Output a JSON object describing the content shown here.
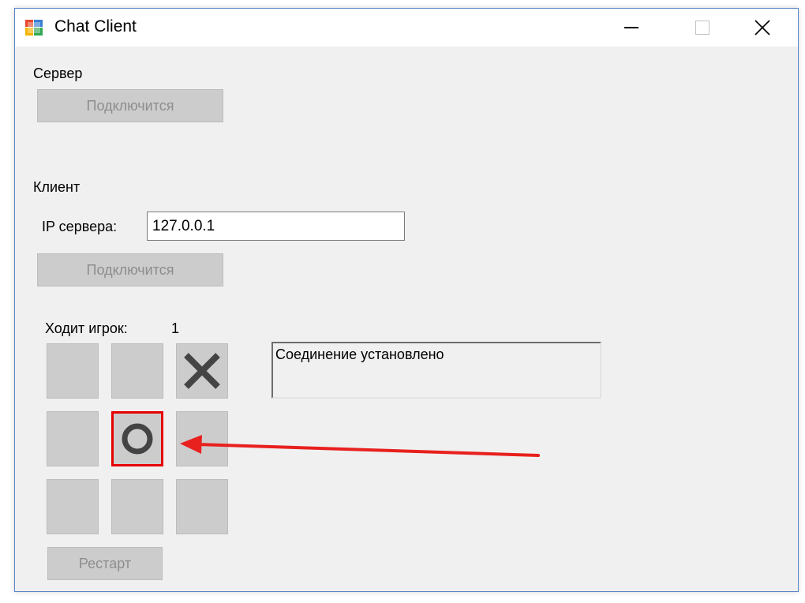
{
  "window": {
    "title": "Chat Client",
    "controls": {
      "minimize": "minimize",
      "maximize": "maximize",
      "close": "close"
    }
  },
  "server": {
    "section_label": "Сервер",
    "connect_button": "Подключится"
  },
  "client": {
    "section_label": "Клиент",
    "ip_label": "IP сервера:",
    "ip_value": "127.0.0.1",
    "connect_button": "Подключится"
  },
  "game": {
    "turn_label": "Ходит игрок:",
    "turn_value": "1",
    "board": [
      "",
      "",
      "X",
      "",
      "O",
      "",
      "",
      "",
      ""
    ],
    "highlighted_cell": 4,
    "restart_button": "Рестарт"
  },
  "status": {
    "message": "Соединение установлено"
  },
  "colors": {
    "highlight": "#e60000",
    "arrow": "#e8201e",
    "mark": "#444444",
    "disabled_button": "#cccccc",
    "window_border": "#5a86c6"
  },
  "icons": {
    "app": "chat-client-app-icon",
    "x_mark": "x-mark-icon",
    "o_mark": "o-mark-icon"
  }
}
